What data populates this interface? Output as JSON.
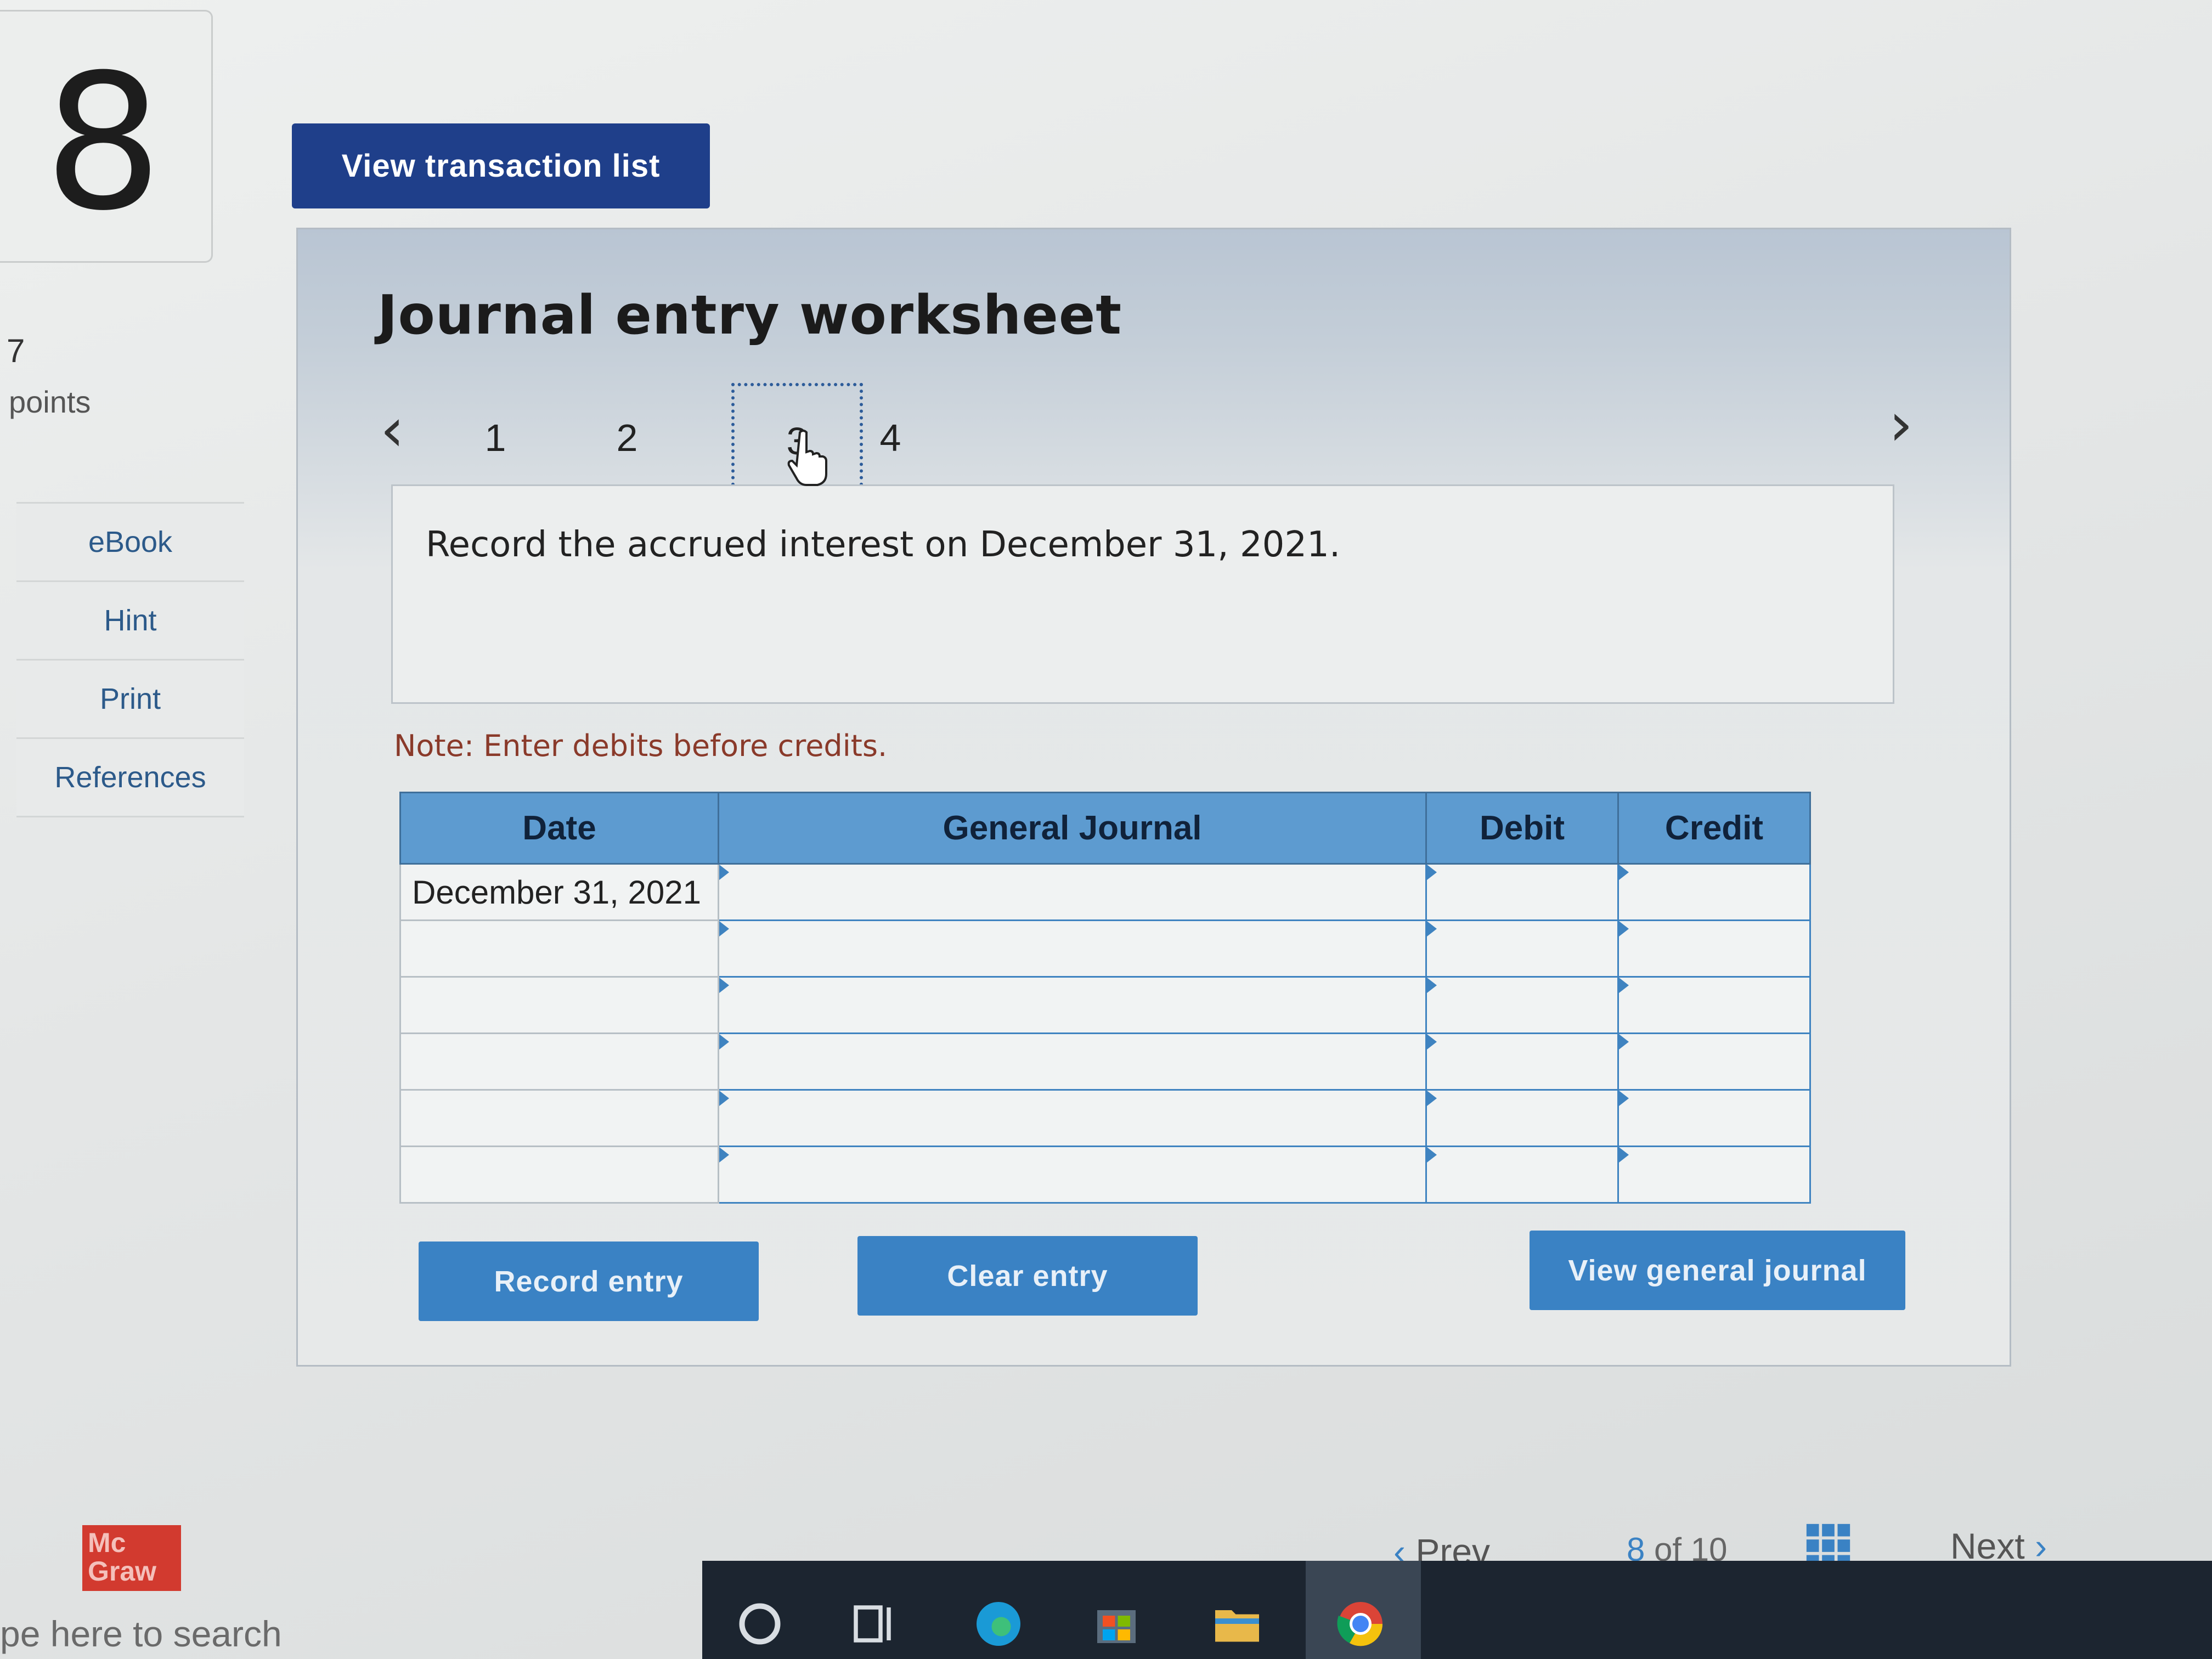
{
  "question": {
    "number": "8",
    "points_value": "7",
    "points_label": "points"
  },
  "side_menu": {
    "items": [
      {
        "label": "eBook"
      },
      {
        "label": "Hint"
      },
      {
        "label": "Print"
      },
      {
        "label": "References"
      }
    ]
  },
  "header": {
    "view_transaction_label": "View transaction list"
  },
  "worksheet": {
    "title": "Journal entry worksheet",
    "tabs": [
      "1",
      "2",
      "3",
      "4"
    ],
    "active_tab": "3",
    "instruction": "Record the accrued interest on December 31, 2021.",
    "note": "Note: Enter debits before credits.",
    "columns": {
      "date": "Date",
      "general_journal": "General Journal",
      "debit": "Debit",
      "credit": "Credit"
    },
    "rows": [
      {
        "date": "December 31, 2021",
        "account": "",
        "debit": "",
        "credit": ""
      },
      {
        "date": "",
        "account": "",
        "debit": "",
        "credit": ""
      },
      {
        "date": "",
        "account": "",
        "debit": "",
        "credit": ""
      },
      {
        "date": "",
        "account": "",
        "debit": "",
        "credit": ""
      },
      {
        "date": "",
        "account": "",
        "debit": "",
        "credit": ""
      },
      {
        "date": "",
        "account": "",
        "debit": "",
        "credit": ""
      }
    ],
    "buttons": {
      "record": "Record entry",
      "clear": "Clear entry",
      "view_general": "View general journal"
    }
  },
  "brand": {
    "line1": "Mc",
    "line2": "Graw"
  },
  "footer": {
    "prev_label": "Prev",
    "current": "8",
    "of_label": "of",
    "total": "10",
    "next_label": "Next"
  },
  "taskbar": {
    "search_text": "pe here to search"
  },
  "colors": {
    "primary_dark": "#1f3f8a",
    "button_blue": "#3a82c4",
    "header_blue": "#5d9bd0",
    "brand_red": "#d23a2f"
  }
}
